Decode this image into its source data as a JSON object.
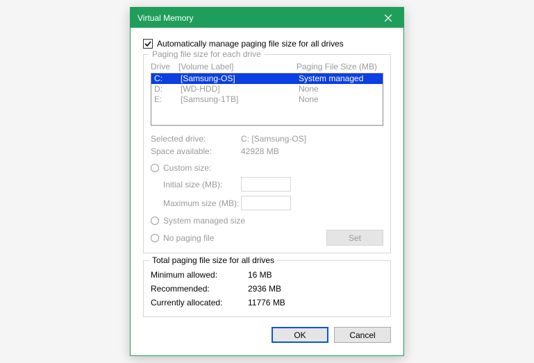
{
  "titlebar": {
    "title": "Virtual Memory"
  },
  "autoManage": {
    "label": "Automatically manage paging file size for all drives",
    "checked": true
  },
  "driveSection": {
    "legend": "Paging file size for each drive",
    "headers": {
      "drive": "Drive",
      "volume": "[Volume Label]",
      "size": "Paging File Size (MB)"
    },
    "rows": [
      {
        "drive": "C:",
        "volume": "[Samsung-OS]",
        "size": "System managed",
        "selected": true
      },
      {
        "drive": "D:",
        "volume": "[WD-HDD]",
        "size": "None",
        "selected": false
      },
      {
        "drive": "E:",
        "volume": "[Samsung-1TB]",
        "size": "None",
        "selected": false
      }
    ],
    "selected": {
      "label": "Selected drive:",
      "value": "C:  [Samsung-OS]"
    },
    "space": {
      "label": "Space available:",
      "value": "42928 MB"
    },
    "customSize": {
      "label": "Custom size:"
    },
    "initialSize": {
      "label": "Initial size (MB):"
    },
    "maxSize": {
      "label": "Maximum size (MB):"
    },
    "systemManaged": {
      "label": "System managed size"
    },
    "noPaging": {
      "label": "No paging file"
    },
    "setBtn": "Set"
  },
  "totalSection": {
    "legend": "Total paging file size for all drives",
    "min": {
      "label": "Minimum allowed:",
      "value": "16 MB"
    },
    "rec": {
      "label": "Recommended:",
      "value": "2936 MB"
    },
    "cur": {
      "label": "Currently allocated:",
      "value": "11776 MB"
    }
  },
  "buttons": {
    "ok": "OK",
    "cancel": "Cancel"
  }
}
